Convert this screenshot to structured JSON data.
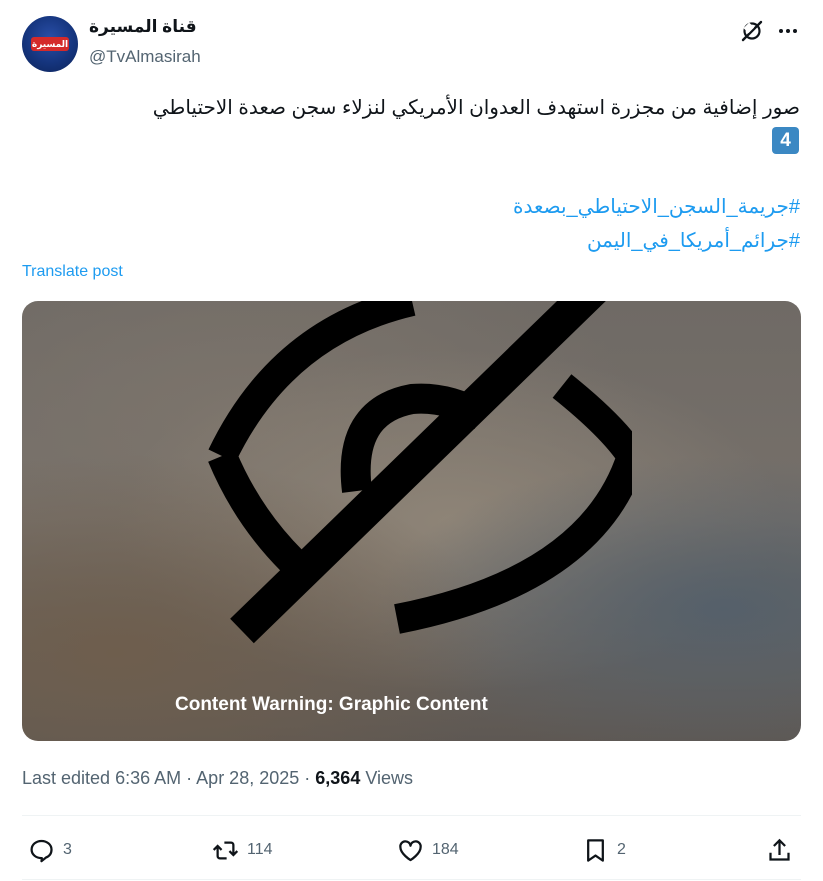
{
  "author": {
    "display_name": "قناة المسيرة",
    "handle": "@TvAlmasirah",
    "avatar_logo_text": "المسيرة"
  },
  "post": {
    "text": "صور إضافية من مجزرة استهدف العدوان الأمريكي لنزلاء سجن صعدة الاحتياطي",
    "keycap": "4",
    "hashtags": [
      "#جريمة_السجن_الاحتياطي_بصعدة",
      "#جرائم_أمريكا_في_اليمن"
    ],
    "translate_label": "Translate post"
  },
  "media": {
    "warning_label": "Content Warning: Graphic Content",
    "icon": "eye-slash-icon"
  },
  "meta": {
    "edited_label": "Last edited",
    "time": "6:36 AM",
    "date": "Apr 28, 2025",
    "views_count": "6,364",
    "views_label": "Views"
  },
  "actions": {
    "replies": "3",
    "reposts": "114",
    "likes": "184",
    "bookmarks": "2"
  },
  "colors": {
    "accent": "#1d9bf0",
    "text": "#0f1419",
    "secondary": "#536471",
    "keycap": "#3b88c3"
  }
}
